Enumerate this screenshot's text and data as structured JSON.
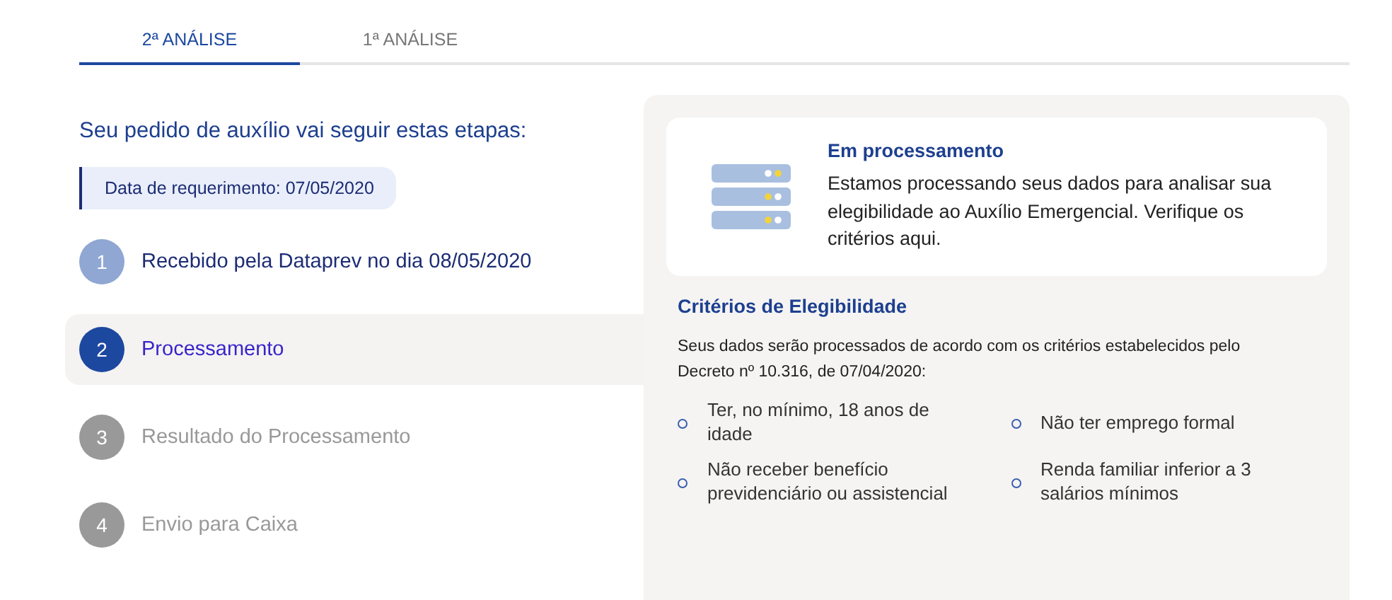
{
  "tabs": [
    {
      "label": "2ª ANÁLISE",
      "selected": true
    },
    {
      "label": "1ª ANÁLISE",
      "selected": false
    }
  ],
  "steps_title": "Seu pedido de auxílio vai seguir estas etapas:",
  "request_date": "Data de requerimento: 07/05/2020",
  "steps": [
    {
      "number": "1",
      "label": "Recebido pela Dataprev no dia 08/05/2020",
      "kind": "done"
    },
    {
      "number": "2",
      "label": "Processamento",
      "kind": "current"
    },
    {
      "number": "3",
      "label": "Resultado do Processamento",
      "kind": "pending"
    },
    {
      "number": "4",
      "label": "Envio para Caixa",
      "kind": "pending"
    }
  ],
  "status_card": {
    "title": "Em processamento",
    "text": "Estamos processando seus dados para analisar sua elegibilidade ao Auxílio Emergencial. Verifique os critérios aqui."
  },
  "criteria": {
    "title": "Critérios de Elegibilidade",
    "intro": "Seus dados serão processados de acordo com os critérios estabelecidos pelo Decreto nº 10.316, de 07/04/2020:",
    "items": [
      "Ter, no mínimo, 18 anos de idade",
      "Não ter emprego formal",
      "Não receber benefício previdenciário ou assistencial",
      "Renda familiar inferior a 3 salários mínimos"
    ]
  }
}
